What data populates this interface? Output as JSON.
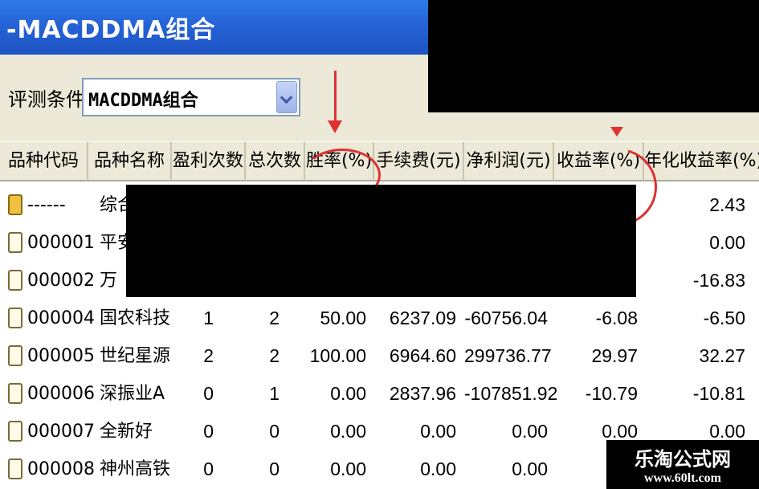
{
  "window": {
    "title": "-MACDDMA组合"
  },
  "condition": {
    "label": "评测条件:",
    "value": "MACDDMA组合"
  },
  "table": {
    "columns": [
      "品种代码",
      "品种名称",
      "盈利次数",
      "总次数",
      "胜率(%)",
      "手续费(元)",
      "净利润(元)",
      "收益率(%)",
      "年化收益率(%)"
    ],
    "rows": [
      {
        "code": "------",
        "name": "综合",
        "win": "",
        "total": "",
        "rate": "",
        "fee": "",
        "profit": "",
        "ret": "",
        "annual": "2.43",
        "icon": "summary"
      },
      {
        "code": "000001",
        "name": "平安",
        "win": "",
        "total": "",
        "rate": "",
        "fee": "",
        "profit": "",
        "ret": "",
        "annual": "0.00",
        "icon": "doc"
      },
      {
        "code": "000002",
        "name": "万",
        "win": "",
        "total": "",
        "rate": "",
        "fee": "",
        "profit": "",
        "ret": "",
        "annual": "-16.83",
        "icon": "doc"
      },
      {
        "code": "000004",
        "name": "国农科技",
        "win": "1",
        "total": "2",
        "rate": "50.00",
        "fee": "6237.09",
        "profit": "-60756.04",
        "ret": "-6.08",
        "annual": "-6.50",
        "icon": "doc"
      },
      {
        "code": "000005",
        "name": "世纪星源",
        "win": "2",
        "total": "2",
        "rate": "100.00",
        "fee": "6964.60",
        "profit": "299736.77",
        "ret": "29.97",
        "annual": "32.27",
        "icon": "doc"
      },
      {
        "code": "000006",
        "name": "深振业A",
        "win": "0",
        "total": "1",
        "rate": "0.00",
        "fee": "2837.96",
        "profit": "-107851.92",
        "ret": "-10.79",
        "annual": "-10.81",
        "icon": "doc"
      },
      {
        "code": "000007",
        "name": "全新好",
        "win": "0",
        "total": "0",
        "rate": "0.00",
        "fee": "0.00",
        "profit": "0.00",
        "ret": "0.00",
        "annual": "0.00",
        "icon": "doc"
      },
      {
        "code": "000008",
        "name": "神州高铁",
        "win": "0",
        "total": "0",
        "rate": "0.00",
        "fee": "0.00",
        "profit": "0.00",
        "ret": "",
        "annual": "",
        "icon": "doc"
      }
    ]
  },
  "watermark": {
    "line1": "乐淘公式网",
    "line2": "www.60lt.com"
  },
  "colors": {
    "titlebar": "#2563d6",
    "toolbar": "#ece9d8",
    "annotation": "#e03030"
  }
}
